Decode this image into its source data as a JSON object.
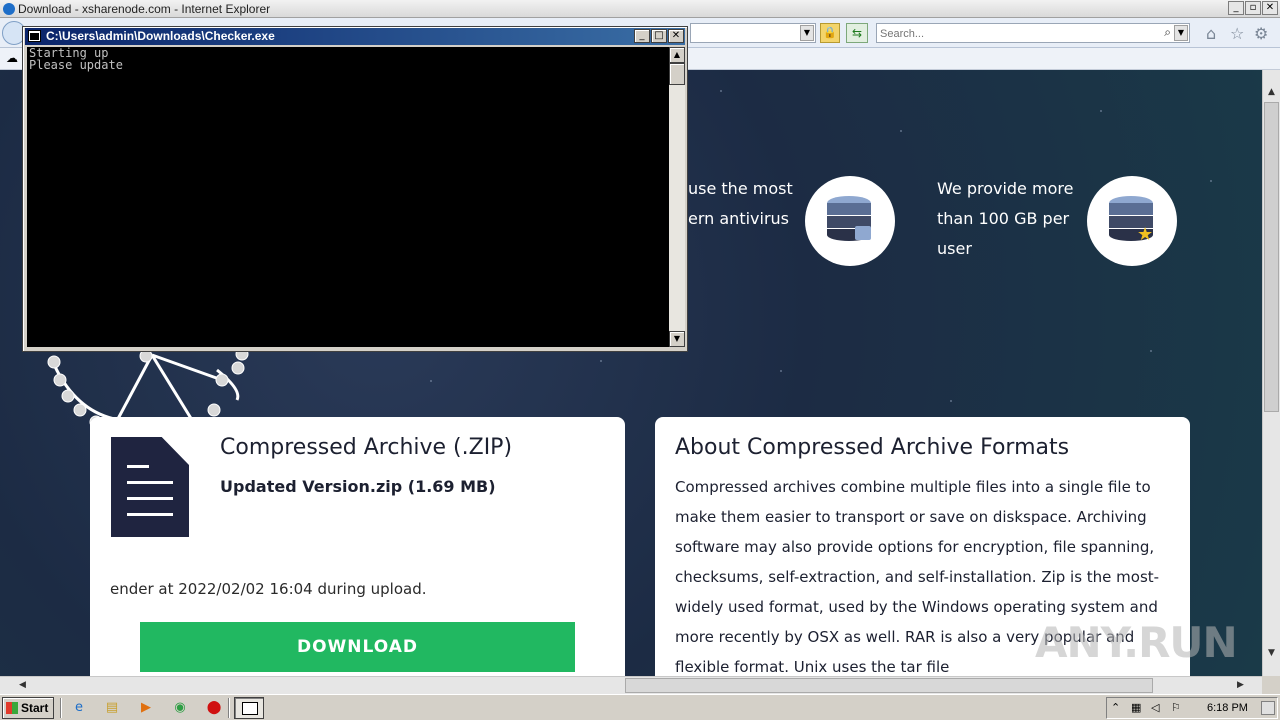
{
  "ie": {
    "title": "Download - xsharenode.com - Internet Explorer",
    "search_placeholder": "Search..."
  },
  "console": {
    "title": "C:\\Users\\admin\\Downloads\\Checker.exe",
    "lines": "Starting up\nPlease update"
  },
  "features": [
    {
      "text_line1": "use the most",
      "text_line2": "ern antivirus"
    },
    {
      "text_line1": "We provide more",
      "text_line2": "than 100 GB per",
      "text_line3": "user"
    }
  ],
  "file_card": {
    "title": "Compressed Archive (.ZIP)",
    "filename": "Updated Version.zip (1.69 MB)",
    "scan_text": "ender at 2022/02/02 16:04 during upload.",
    "download_label": "DOWNLOAD"
  },
  "about_card": {
    "title": "About Compressed Archive Formats",
    "body": "Compressed archives combine multiple files into a single file to make them easier to transport or save on diskspace. Archiving software may also provide options for encryption, file spanning, checksums, self-extraction, and self-installation. Zip is the most-widely used format, used by the Windows operating system and more recently by OSX as well. RAR is also a very popular and flexible format. Unix uses the tar file"
  },
  "watermark": "ANY.RUN",
  "taskbar": {
    "start_label": "Start",
    "clock": "6:18 PM"
  },
  "colors": {
    "download_button": "#21b861",
    "console_title": "#0a246a",
    "page_bg": "#1c2b44"
  }
}
